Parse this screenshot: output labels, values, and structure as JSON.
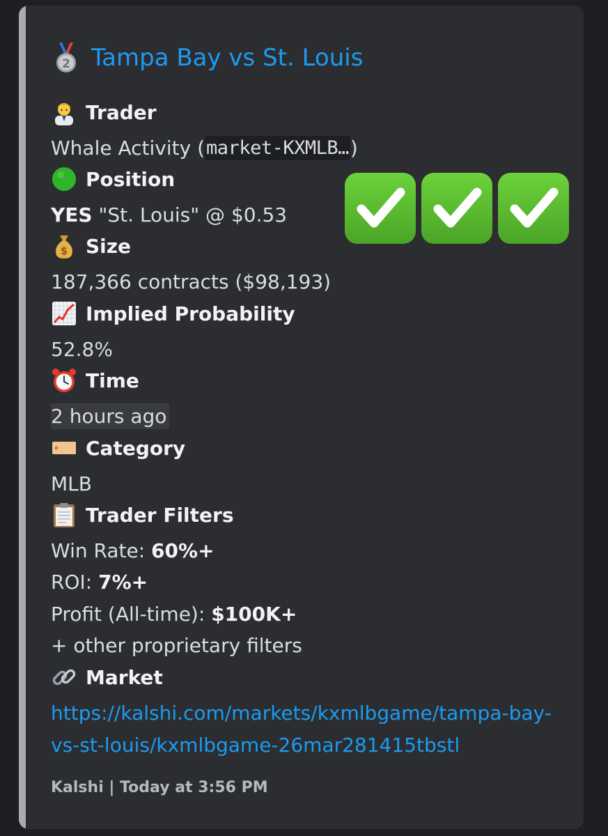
{
  "title": {
    "icon": "second-place-medal-icon",
    "text": "Tampa Bay vs St. Louis"
  },
  "fields": {
    "trader": {
      "icon": "office-worker-icon",
      "name": "Trader",
      "value_prefix": "Whale Activity (",
      "value_code": "market-KXMLB…",
      "value_suffix": ")"
    },
    "position": {
      "icon": "green-circle-icon",
      "name": "Position",
      "side": "YES",
      "rest": " \"St. Louis\" @ $0.53"
    },
    "size": {
      "icon": "money-bag-icon",
      "name": "Size",
      "value": "187,366 contracts ($98,193)"
    },
    "implied_probability": {
      "icon": "chart-increasing-icon",
      "name": "Implied Probability",
      "value": "52.8%"
    },
    "time": {
      "icon": "alarm-clock-icon",
      "name": "Time",
      "value": "2 hours ago"
    },
    "category": {
      "icon": "label-tag-icon",
      "name": "Category",
      "value": "MLB"
    },
    "trader_filters": {
      "icon": "clipboard-icon",
      "name": "Trader Filters",
      "win_rate_label": "Win Rate: ",
      "win_rate_value": "60%+",
      "roi_label": "ROI: ",
      "roi_value": "7%+",
      "profit_label": "Profit (All-time): ",
      "profit_value": "$100K+",
      "other": "+ other proprietary filters"
    },
    "market": {
      "icon": "link-icon",
      "name": "Market",
      "url": "https://kalshi.com/markets/kxmlbgame/tampa-bay-vs-st-louis/kxmlbgame-26mar281415tbstl"
    }
  },
  "checkmarks": [
    "check-mark-button-icon",
    "check-mark-button-icon",
    "check-mark-button-icon"
  ],
  "footer": {
    "text": "Kalshi | Today at 3:56 PM"
  },
  "colors": {
    "background": "#1e1f22",
    "embed": "#2b2d31",
    "embed_bar": "#a9abaf",
    "link": "#1d9bf0",
    "check_green": "#5bbf2f"
  }
}
